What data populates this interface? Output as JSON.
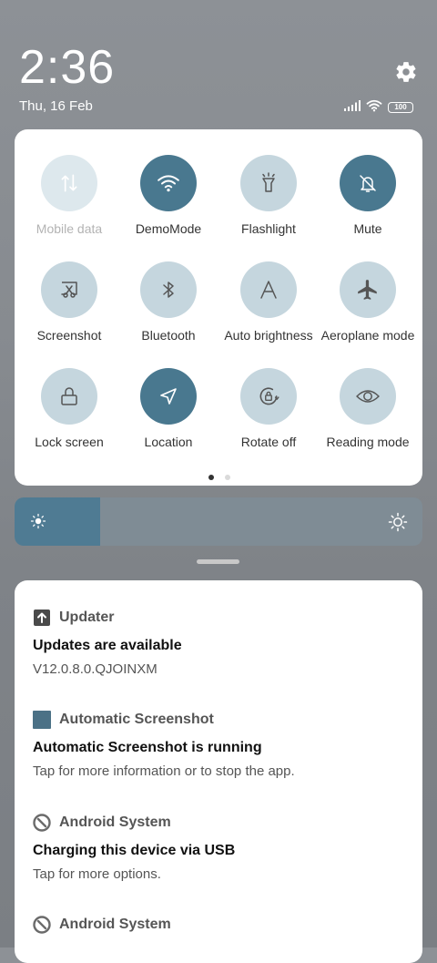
{
  "status": {
    "time": "2:36",
    "date": "Thu, 16 Feb",
    "battery": "100"
  },
  "quick_settings": {
    "tiles": [
      {
        "label": "Mobile data",
        "icon": "mobile-data-icon",
        "state": "disabled"
      },
      {
        "label": "DemoMode",
        "icon": "wifi-icon",
        "state": "on"
      },
      {
        "label": "Flashlight",
        "icon": "flashlight-icon",
        "state": "off"
      },
      {
        "label": "Mute",
        "icon": "bell-off-icon",
        "state": "on"
      },
      {
        "label": "Screenshot",
        "icon": "screenshot-icon",
        "state": "off"
      },
      {
        "label": "Bluetooth",
        "icon": "bluetooth-icon",
        "state": "off"
      },
      {
        "label": "Auto brightness",
        "icon": "auto-brightness-icon",
        "state": "off"
      },
      {
        "label": "Aeroplane mode",
        "icon": "airplane-icon",
        "state": "off"
      },
      {
        "label": "Lock screen",
        "icon": "lock-icon",
        "state": "off"
      },
      {
        "label": "Location",
        "icon": "location-icon",
        "state": "on"
      },
      {
        "label": "Rotate off",
        "icon": "rotate-lock-icon",
        "state": "off"
      },
      {
        "label": "Reading mode",
        "icon": "eye-icon",
        "state": "off"
      }
    ],
    "page_count": 2,
    "current_page": 1
  },
  "brightness": {
    "level": 0.21
  },
  "notifications": [
    {
      "app": "Updater",
      "icon": "updater-icon",
      "title": "Updates are available",
      "body": "V12.0.8.0.QJOINXM"
    },
    {
      "app": "Automatic Screenshot",
      "icon": "app-square-icon",
      "title": "Automatic Screenshot is running",
      "body": "Tap for more information or to stop the app."
    },
    {
      "app": "Android System",
      "icon": "android-system-icon",
      "title": "Charging this device via USB",
      "body": "Tap for more options."
    },
    {
      "app": "Android System",
      "icon": "android-system-icon",
      "title": "",
      "body": ""
    }
  ],
  "colors": {
    "tile_on": "#49788f",
    "tile_off": "#c5d6de",
    "brightness_fill": "#4f7b93"
  }
}
